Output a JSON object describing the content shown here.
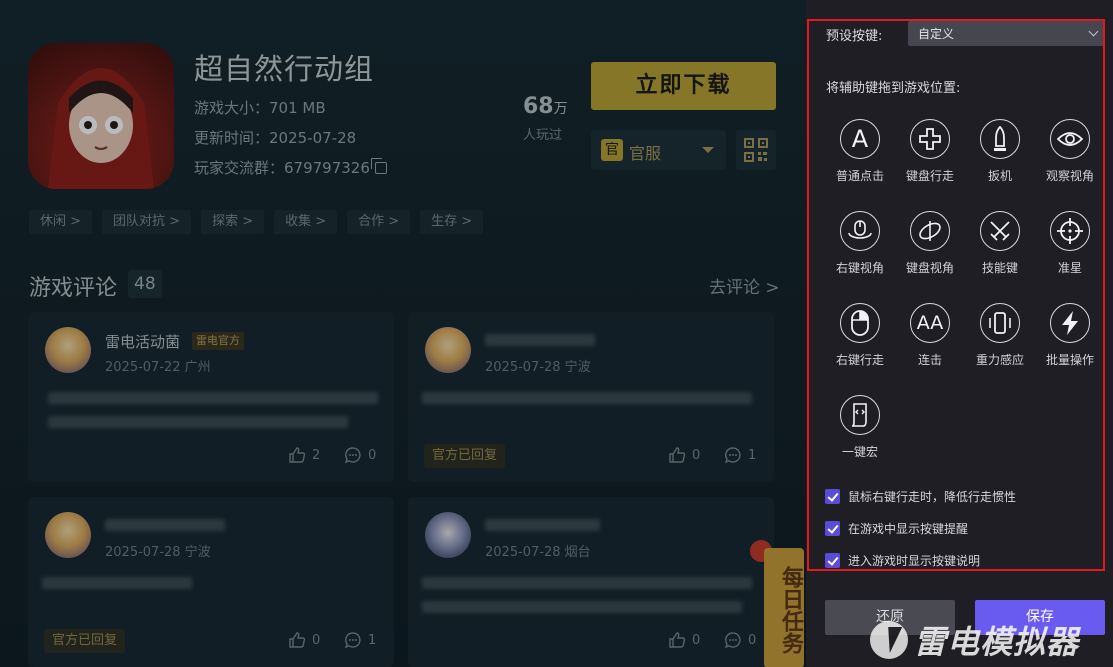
{
  "game": {
    "title": "超自然行动组",
    "size": "游戏大小：701 MB",
    "update": "更新时间：2025-07-28",
    "group": "玩家交流群：679797326",
    "players_count": "68",
    "players_unit": "万",
    "players_label": "人玩过",
    "download_label": "立即下载",
    "server_badge": "官",
    "server_label": "官服",
    "tags": [
      "休闲 >",
      "团队对抗 >",
      "探索 >",
      "收集 >",
      "合作 >",
      "生存 >"
    ]
  },
  "reviews": {
    "title": "游戏评论",
    "count": "48",
    "go_review": "去评论 >",
    "cards": [
      {
        "author": "雷电活动菌",
        "badge": "雷电官方",
        "date": "2025-07-22 广州",
        "reply": "",
        "likes": "2",
        "comments": "0"
      },
      {
        "author": "",
        "badge": "",
        "date": "2025-07-28 宁波",
        "reply": "官方已回复",
        "likes": "0",
        "comments": "1"
      },
      {
        "author": "",
        "badge": "",
        "date": "2025-07-28 宁波",
        "reply": "官方已回复",
        "likes": "0",
        "comments": "1"
      },
      {
        "author": "",
        "badge": "",
        "date": "2025-07-28 烟台",
        "reply": "",
        "likes": "0",
        "comments": "0"
      }
    ]
  },
  "daily_task": "每日任务",
  "panel": {
    "preset_label": "预设按键:",
    "preset_value": "自定义",
    "drag_hint": "将辅助键拖到游戏位置:",
    "keys": [
      {
        "label": "普通点击",
        "icon": "letter-a-icon",
        "glyph": "A"
      },
      {
        "label": "键盘行走",
        "icon": "dpad-cross-icon",
        "glyph": ""
      },
      {
        "label": "扳机",
        "icon": "bullet-icon",
        "glyph": ""
      },
      {
        "label": "观察视角",
        "icon": "eye-icon",
        "glyph": ""
      },
      {
        "label": "右键视角",
        "icon": "mouse-rotate-icon",
        "glyph": ""
      },
      {
        "label": "键盘视角",
        "icon": "keyboard-rotate-icon",
        "glyph": ""
      },
      {
        "label": "技能键",
        "icon": "crossed-swords-icon",
        "glyph": ""
      },
      {
        "label": "准星",
        "icon": "crosshair-icon",
        "glyph": ""
      },
      {
        "label": "右键行走",
        "icon": "mouse-icon",
        "glyph": ""
      },
      {
        "label": "连击",
        "icon": "double-a-icon",
        "glyph": "AA"
      },
      {
        "label": "重力感应",
        "icon": "phone-tilt-icon",
        "glyph": ""
      },
      {
        "label": "批量操作",
        "icon": "lightning-icon",
        "glyph": ""
      },
      {
        "label": "一键宏",
        "icon": "script-icon",
        "glyph": ""
      }
    ],
    "options": [
      "鼠标右键行走时，降低行走惯性",
      "在游戏中显示按键提醒",
      "进入游戏时显示按键说明"
    ],
    "reset_label": "还原",
    "save_label": "保存"
  },
  "watermark": "雷电模拟器",
  "colors": {
    "accent": "#6a5bf0",
    "highlight": "#e1181d",
    "download": "#b8a032"
  }
}
